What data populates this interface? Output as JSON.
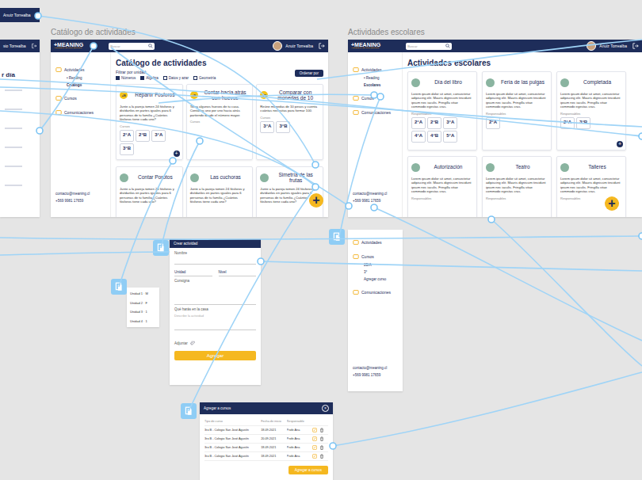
{
  "canvas_labels": {
    "catalog": "Catálogo de actividades",
    "activities": "Actividades escolares"
  },
  "top_fragment": {
    "user": "Anuiz Torrealba"
  },
  "left_fragment": {
    "user": "sio Torrealba",
    "title": "r día"
  },
  "catalog": {
    "header": {
      "logo": "+MEANING",
      "logo_sub": "APRENDIZAJE CON SENTIDO",
      "search_placeholder": "Buscar",
      "user": "Anuiz Torrealba"
    },
    "sidebar": {
      "items": [
        {
          "label": "Actividades",
          "kind": "section",
          "selected": false
        },
        {
          "label": "• Reading",
          "kind": "sub",
          "selected": false
        },
        {
          "label": "Catálogo",
          "kind": "sub",
          "selected": true
        },
        {
          "label": "Cursos",
          "kind": "section",
          "selected": false
        },
        {
          "label": "Comunicaciones",
          "kind": "section",
          "selected": false
        }
      ],
      "contact": [
        "contacto@meaning.cl",
        "+569 9981 17659"
      ]
    },
    "title": "Catálogo de actividades",
    "filter_label": "Filtrar por unidad:",
    "filters": [
      {
        "label": "Números",
        "checked": true
      },
      {
        "label": "Algebra",
        "checked": true
      },
      {
        "label": "Datos y azar",
        "checked": false
      },
      {
        "label": "Geometría",
        "checked": false
      }
    ],
    "sort_button": "Ordenar por",
    "cards": [
      {
        "badge": "+N",
        "title": "Repartir Fósforos",
        "description": "Junte a la pareja tomen 24 fósforos y divídanlos en partes iguales para 6 personas de tu familia ¿Cuántos fósforos tiene cada uno?",
        "courses_label": "Cursos",
        "courses": [
          "2°A",
          "2°B",
          "3°A",
          "3°B"
        ],
        "add": "+"
      },
      {
        "badge": "+N",
        "title": "Contar hacia atrás con huevos",
        "description": "Toma algunos huevos de tu casa. Contarlos uno por uno hacia atrás partiendo desde el número mayor.",
        "courses_label": "Cursos",
        "courses": [],
        "add": ""
      },
      {
        "badge": "+N",
        "title": "Comparar con monedas de 10",
        "description": "Reúne monedas de 10 pesos y cuenta cuántas necesitas para formar 100.",
        "courses_label": "Cursos",
        "courses": [
          "3°A",
          "3°B"
        ],
        "add": ""
      },
      {
        "badge": "",
        "title": "Contar Porotos",
        "description": "Junte a la pareja tomen 24 fósforos y divídanlos en partes iguales para 6 personas de tu familia ¿Cuántos fósforos tiene cada uno?",
        "courses_label": "",
        "courses": [],
        "add": ""
      },
      {
        "badge": "",
        "title": "Las cuchoras",
        "description": "Junte a la pareja tomen 24 fósforos y divídanlos en partes iguales para 6 personas de tu familia ¿Cuántos fósforos tiene cada uno?",
        "courses_label": "",
        "courses": [],
        "add": ""
      },
      {
        "badge": "",
        "title": "Simetría de las frutas",
        "description": "Junte a la pareja tomen 24 fósforos y divídanlos en partes iguales para 6 personas de tu familia ¿Cuántos fósforos tiene cada uno?",
        "courses_label": "",
        "courses": [],
        "add": ""
      }
    ],
    "fab": "+"
  },
  "activities": {
    "header": {
      "logo": "+MEANING",
      "logo_sub": "APRENDIZAJE CON SENTIDO",
      "search_placeholder": "Buscar",
      "user": "Anuiz Torrealba"
    },
    "sidebar": {
      "items": [
        {
          "label": "Actividades",
          "kind": "section",
          "selected": false
        },
        {
          "label": "• Reading",
          "kind": "sub",
          "selected": false
        },
        {
          "label": "Escolares",
          "kind": "sub",
          "selected": true
        },
        {
          "label": "Cursos",
          "kind": "section",
          "selected": false
        },
        {
          "label": "Comunicaciones",
          "kind": "section",
          "selected": false
        }
      ],
      "contact": [
        "contacto@meaning.cl",
        "+569 9981 17659"
      ]
    },
    "title": "Actividades escolares",
    "cards": [
      {
        "title": "Día del libro",
        "description": "Lorem ipsum dolor sit amet, consectetur adipiscing elit. Mauris dignissim tincidunt ipsum nec iaculis. Fringilla vitae commodo egestas cras.",
        "courses_label": "Responsables",
        "courses": [
          "2°A",
          "2°B",
          "3°A",
          "4°A",
          "4°B",
          "5°A"
        ],
        "add": ""
      },
      {
        "title": "Feria de las pulgas",
        "description": "Lorem ipsum dolor sit amet, consectetur adipiscing elit. Mauris dignissim tincidunt ipsum nec iaculis. Fringilla vitae commodo egestas cras.",
        "courses_label": "Responsables",
        "courses": [
          "2°A"
        ],
        "add": ""
      },
      {
        "title": "Completada",
        "description": "Lorem ipsum dolor sit amet, consectetur adipiscing elit. Mauris dignissim tincidunt ipsum nec iaculis. Fringilla vitae commodo egestas cras.",
        "courses_label": "Responsables",
        "courses": [
          "2°A",
          "3°B"
        ],
        "add": "+"
      },
      {
        "title": "Autorización",
        "description": "Lorem ipsum dolor sit amet, consectetur adipiscing elit. Mauris dignissim tincidunt ipsum nec iaculis. Fringilla vitae commodo egestas cras.",
        "courses_label": "Responsables",
        "courses": [],
        "add": ""
      },
      {
        "title": "Teatro",
        "description": "Lorem ipsum dolor sit amet, consectetur adipiscing elit. Mauris dignissim tincidunt ipsum nec iaculis. Fringilla vitae commodo egestas cras.",
        "courses_label": "Responsables",
        "courses": [],
        "add": ""
      },
      {
        "title": "Talleres",
        "description": "Lorem ipsum dolor sit amet, consectetur adipiscing elit. Mauris dignissim tincidunt ipsum nec iaculis. Fringilla vitae commodo egestas cras.",
        "courses_label": "Responsables",
        "courses": [],
        "add": ""
      }
    ],
    "fab": "+"
  },
  "sidebar_fragment": {
    "items": [
      {
        "label": "Actividades",
        "kind": "section"
      },
      {
        "label": "Cursos",
        "kind": "section"
      },
      {
        "label": "2B/A",
        "kind": "sub"
      },
      {
        "label": "3°",
        "kind": "sub"
      },
      {
        "label": "Agregar curso",
        "kind": "sub"
      },
      {
        "label": "Comunicaciones",
        "kind": "section"
      }
    ],
    "contact": [
      "contacto@meaning.cl",
      "+569 9981 17659"
    ]
  },
  "create_modal": {
    "title": "Crear actividad",
    "name_label": "Nombre",
    "unit_value": "Unidad",
    "level_value": "Nivel",
    "instructions_label": "Consigna",
    "home_label": "Qué harás en la casa",
    "home_placeholder": "Describe la actividad",
    "attach_label": "Adjuntar",
    "submit": "Agregar"
  },
  "unit_dropdown": {
    "items": [
      "Unidad 1 · M",
      "Unidad 2 · F",
      "Unidad 3 · 1",
      "Unidad 4 · 1"
    ]
  },
  "courses_modal": {
    "title": "Agregar a cursos",
    "close": "×",
    "columns": [
      "Tipo de curso",
      "Fecha de inicio",
      "Responsable"
    ],
    "rows": [
      [
        "3ro B - Colegio San José Agustín",
        "18.09.2021",
        "Profe Ana"
      ],
      [
        "3ro B - Colegio San José Agustín",
        "20.09.2021",
        "Profe Ana"
      ],
      [
        "3ro B - Colegio San José Agustín",
        "18.09.2021",
        "Profe Ana"
      ],
      [
        "3ro B - Colegio San José Agustín",
        "18.09.2021",
        "Profe Ana"
      ]
    ],
    "submit": "Agregar a cursos"
  }
}
